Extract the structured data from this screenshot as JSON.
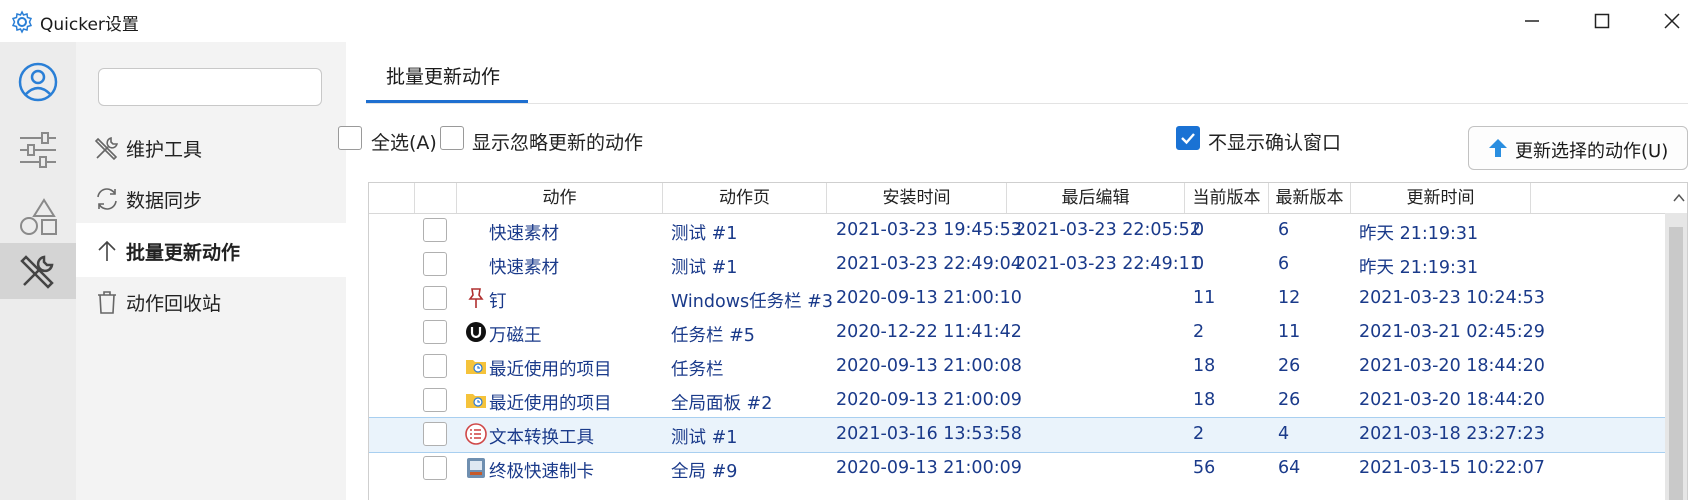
{
  "window": {
    "title": "Quicker设置",
    "minimize": "minimize",
    "maximize": "maximize",
    "close": "close"
  },
  "rail": [
    "user-icon",
    "sliders-icon",
    "shapes-icon",
    "tools-icon"
  ],
  "nav": {
    "search_value": "",
    "items": [
      {
        "label": "维护工具",
        "icon": "wrench-screwdriver-icon"
      },
      {
        "label": "数据同步",
        "icon": "sync-icon"
      },
      {
        "label": "批量更新动作",
        "icon": "arrow-up-icon"
      },
      {
        "label": "动作回收站",
        "icon": "trash-icon"
      }
    ]
  },
  "main": {
    "tab": "批量更新动作",
    "select_all": "全选(A)",
    "show_ignored": "显示忽略更新的动作",
    "no_confirm": "不显示确认窗口",
    "update_button": "更新选择的动作(U)"
  },
  "table": {
    "columns": [
      "动作",
      "动作页",
      "安装时间",
      "最后编辑",
      "当前版本",
      "最新版本",
      "更新时间"
    ],
    "rows": [
      {
        "icon": "none",
        "name": "快速素材",
        "page": "测试 #1",
        "installed": "2021-03-23 19:45:53",
        "edited": "2021-03-23 22:05:52",
        "current": "0",
        "latest": "6",
        "updated": "昨天 21:19:31"
      },
      {
        "icon": "none",
        "name": "快速素材",
        "page": "测试 #1",
        "installed": "2021-03-23 22:49:04",
        "edited": "2021-03-23 22:49:11",
        "current": "0",
        "latest": "6",
        "updated": "昨天 21:19:31"
      },
      {
        "icon": "pin-icon",
        "name": "钉",
        "page": "Windows任务栏 #3",
        "installed": "2020-09-13 21:00:10",
        "edited": "",
        "current": "11",
        "latest": "12",
        "updated": "2021-03-23 10:24:53"
      },
      {
        "icon": "magnet-u-icon",
        "name": "万磁王",
        "page": "任务栏 #5",
        "installed": "2020-12-22 11:41:42",
        "edited": "",
        "current": "2",
        "latest": "11",
        "updated": "2021-03-21 02:45:29"
      },
      {
        "icon": "folder-recent-icon",
        "name": "最近使用的项目",
        "page": "任务栏",
        "installed": "2020-09-13 21:00:08",
        "edited": "",
        "current": "18",
        "latest": "26",
        "updated": "2021-03-20 18:44:20"
      },
      {
        "icon": "folder-recent-icon",
        "name": "最近使用的项目",
        "page": "全局面板 #2",
        "installed": "2020-09-13 21:00:09",
        "edited": "",
        "current": "18",
        "latest": "26",
        "updated": "2021-03-20 18:44:20"
      },
      {
        "icon": "list-circle-icon",
        "name": "文本转换工具",
        "page": "测试 #1",
        "installed": "2021-03-16 13:53:58",
        "edited": "",
        "current": "2",
        "latest": "4",
        "updated": "2021-03-18 23:27:23"
      },
      {
        "icon": "card-icon",
        "name": "终极快速制卡",
        "page": "全局 #9",
        "installed": "2020-09-13 21:00:09",
        "edited": "",
        "current": "56",
        "latest": "64",
        "updated": "2021-03-15 10:22:07"
      }
    ],
    "selected_row": 6
  },
  "colors": {
    "accent": "#1e6fd0",
    "link_text": "#1a3a8a",
    "selected_row": "#eaf3fb"
  }
}
